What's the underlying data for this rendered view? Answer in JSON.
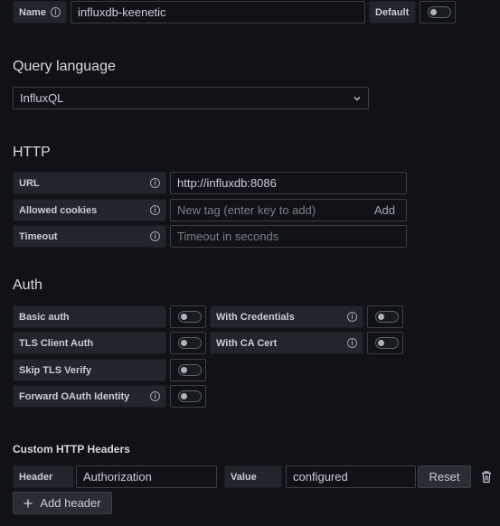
{
  "name_row": {
    "label": "Name",
    "value": "influxdb-keenetic",
    "default_label": "Default",
    "default_on": false
  },
  "query_language": {
    "heading": "Query language",
    "selected": "InfluxQL"
  },
  "http": {
    "heading": "HTTP",
    "url_label": "URL",
    "url_value": "http://influxdb:8086",
    "cookies_label": "Allowed cookies",
    "cookies_placeholder": "New tag (enter key to add)",
    "cookies_add": "Add",
    "timeout_label": "Timeout",
    "timeout_placeholder": "Timeout in seconds"
  },
  "auth": {
    "heading": "Auth",
    "basic_auth": "Basic auth",
    "with_credentials": "With Credentials",
    "tls_client_auth": "TLS Client Auth",
    "with_ca_cert": "With CA Cert",
    "skip_tls_verify": "Skip TLS Verify",
    "forward_oauth": "Forward OAuth Identity"
  },
  "custom_headers": {
    "heading": "Custom HTTP Headers",
    "header_label": "Header",
    "header_value": "Authorization",
    "value_label": "Value",
    "value_value": "configured",
    "reset_label": "Reset",
    "add_label": "Add header"
  },
  "icons": {
    "info": "info-circle-icon",
    "chevron": "chevron-down-icon",
    "trash": "trash-icon",
    "plus": "plus-icon"
  },
  "colors": {
    "background": "#111217",
    "label_bg": "#22252b",
    "border": "#3b3d43"
  }
}
